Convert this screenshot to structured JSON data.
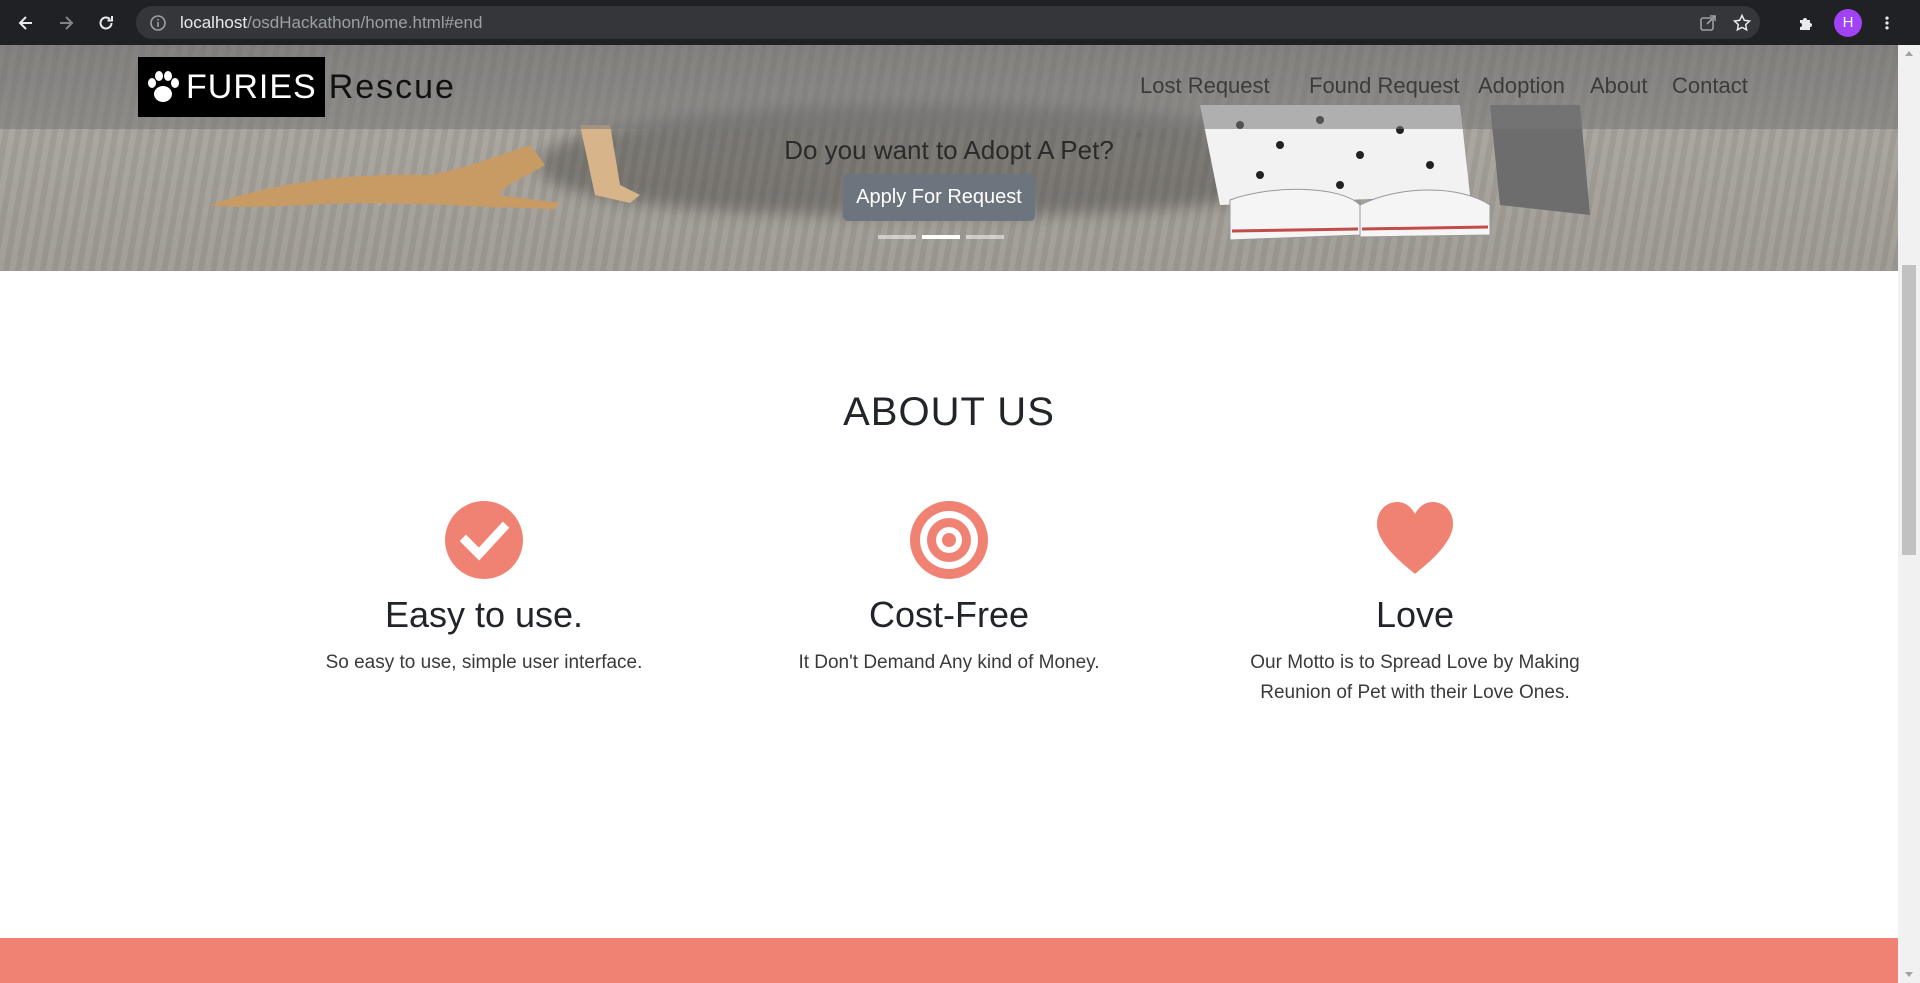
{
  "browser": {
    "url_host": "localhost",
    "url_path": "/osdHackathon/home.html#end",
    "profile_initial": "H"
  },
  "navbar": {
    "brand_bold": "FURIES",
    "brand_rest": "Rescue",
    "links": [
      "Lost Request",
      "Found Request",
      "Adoption",
      "About",
      "Contact"
    ]
  },
  "hero": {
    "caption": "Do you want to Adopt A Pet?",
    "button_label": "Apply For Request",
    "active_slide": 2,
    "slide_count": 3
  },
  "about": {
    "title": "ABOUT US",
    "features": [
      {
        "icon": "check-circle-icon",
        "title": "Easy to use.",
        "text": "So easy to use, simple user interface."
      },
      {
        "icon": "target-icon",
        "title": "Cost-Free",
        "text": "It Don't Demand Any kind of Money."
      },
      {
        "icon": "heart-icon",
        "title": "Love",
        "text": "Our Motto is to Spread Love by Making Reunion of Pet with their Love Ones."
      }
    ]
  },
  "colors": {
    "accent": "#f08273",
    "button": "#6c757d",
    "chrome": "#202124"
  }
}
